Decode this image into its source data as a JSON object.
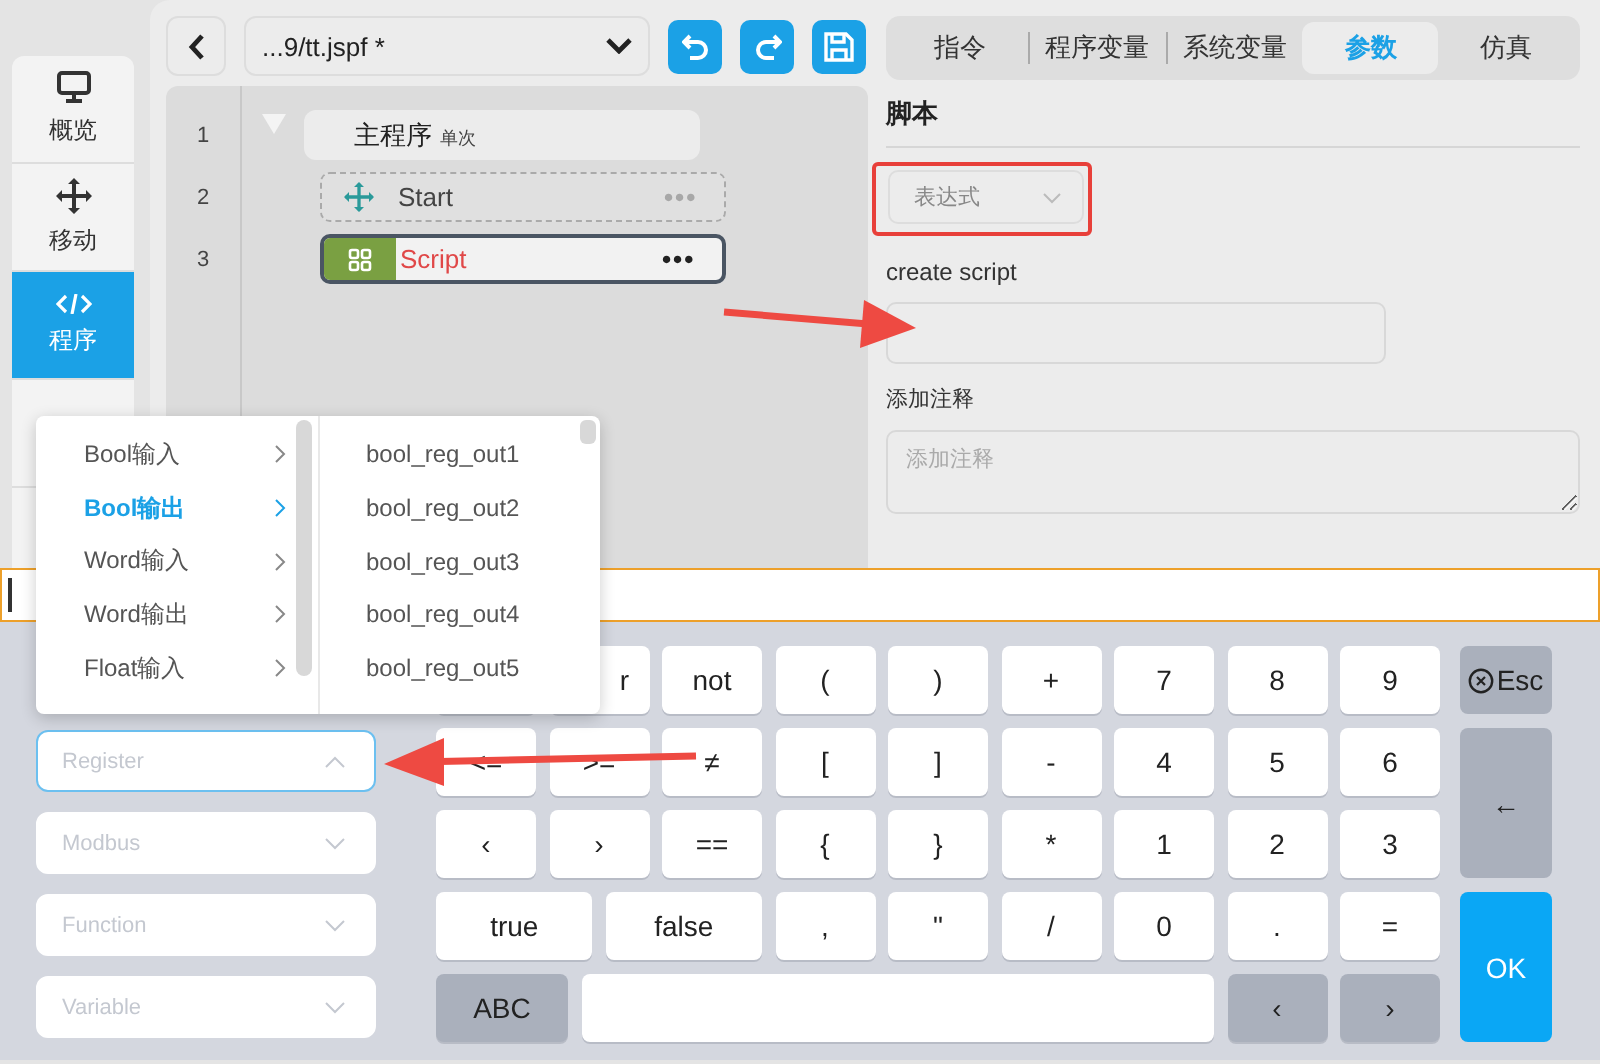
{
  "sidebar": {
    "items": [
      {
        "label": "概览",
        "selected": false
      },
      {
        "label": "移动",
        "selected": false
      },
      {
        "label": "程序",
        "selected": true
      },
      {
        "selected": false
      }
    ]
  },
  "toolbar": {
    "file": "...9/tt.jspf *"
  },
  "program": {
    "lines": [
      {
        "number": "1",
        "kind": "main",
        "label": "主程序",
        "tag": "单次",
        "expanded": true
      },
      {
        "number": "2",
        "kind": "move",
        "label": "Start",
        "more": "•••",
        "selected": false
      },
      {
        "number": "3",
        "kind": "script",
        "label": "Script",
        "more": "•••",
        "selected": true
      }
    ]
  },
  "tabs": [
    {
      "label": "指令",
      "selected": false
    },
    {
      "label": "程序变量",
      "selected": false
    },
    {
      "label": "系统变量",
      "selected": false
    },
    {
      "label": "参数",
      "selected": true
    },
    {
      "label": "仿真",
      "selected": false
    }
  ],
  "params": {
    "title": "脚本",
    "mode_select": {
      "value": "表达式"
    },
    "script_label": "create script",
    "comment_label": "添加注释",
    "comment": {
      "placeholder": "添加注释"
    }
  },
  "selectors": [
    {
      "placeholder": "Register",
      "expanded": true
    },
    {
      "placeholder": "Modbus",
      "expanded": false
    },
    {
      "placeholder": "Function",
      "expanded": false
    },
    {
      "placeholder": "Variable",
      "expanded": false
    }
  ],
  "register_menu": {
    "categories": [
      {
        "label": "Bool输入",
        "selected": false
      },
      {
        "label": "Bool输出",
        "selected": true
      },
      {
        "label": "Word输入",
        "selected": false
      },
      {
        "label": "Word输出",
        "selected": false
      },
      {
        "label": "Float输入",
        "selected": false
      }
    ],
    "items": [
      "bool_reg_out1",
      "bool_reg_out2",
      "bool_reg_out3",
      "bool_reg_out4",
      "bool_reg_out5"
    ]
  },
  "keyboard": {
    "rows": [
      {
        "keys": [
          {
            "kind": "key"
          },
          {
            "kind": "cut",
            "label": "r"
          },
          {
            "kind": "key",
            "label": "not"
          },
          {
            "kind": "key",
            "label": "("
          },
          {
            "kind": "key",
            "label": ")"
          },
          {
            "kind": "key",
            "label": "+"
          },
          {
            "kind": "key",
            "label": "7"
          },
          {
            "kind": "key",
            "label": "8"
          },
          {
            "kind": "key",
            "label": "9"
          }
        ]
      },
      {
        "keys": [
          {
            "kind": "key",
            "label": "<="
          },
          {
            "kind": "key",
            "label": ">="
          },
          {
            "kind": "key",
            "label": "≠"
          },
          {
            "kind": "key",
            "label": "["
          },
          {
            "kind": "key",
            "label": "]"
          },
          {
            "kind": "key",
            "label": "-"
          },
          {
            "kind": "key",
            "label": "4"
          },
          {
            "kind": "key",
            "label": "5"
          },
          {
            "kind": "key",
            "label": "6"
          }
        ]
      },
      {
        "keys": [
          {
            "kind": "key",
            "label": "‹"
          },
          {
            "kind": "key",
            "label": "›"
          },
          {
            "kind": "key",
            "label": "=="
          },
          {
            "kind": "key",
            "label": "{"
          },
          {
            "kind": "key",
            "label": "}"
          },
          {
            "kind": "key",
            "label": "*"
          },
          {
            "kind": "key",
            "label": "1"
          },
          {
            "kind": "key",
            "label": "2"
          },
          {
            "kind": "key",
            "label": "3"
          }
        ]
      },
      {
        "keys": [
          {
            "kind": "wide",
            "label": "true"
          },
          {
            "kind": "wide",
            "label": "false"
          },
          {
            "kind": "key",
            "label": ","
          },
          {
            "kind": "key",
            "label": "\""
          },
          {
            "kind": "key",
            "label": "/"
          },
          {
            "kind": "key",
            "label": "0"
          },
          {
            "kind": "key",
            "label": "."
          },
          {
            "kind": "key",
            "label": "="
          }
        ]
      },
      {
        "keys": [
          {
            "kind": "function",
            "label": "ABC"
          },
          {
            "kind": "space"
          },
          {
            "kind": "function",
            "label": "‹"
          },
          {
            "kind": "function",
            "label": "›"
          }
        ]
      }
    ],
    "side_keys": [
      {
        "kind": "escape",
        "label": "Esc"
      },
      {
        "kind": "backspace",
        "label": "←"
      },
      {
        "kind": "enter",
        "label": "OK"
      }
    ]
  }
}
